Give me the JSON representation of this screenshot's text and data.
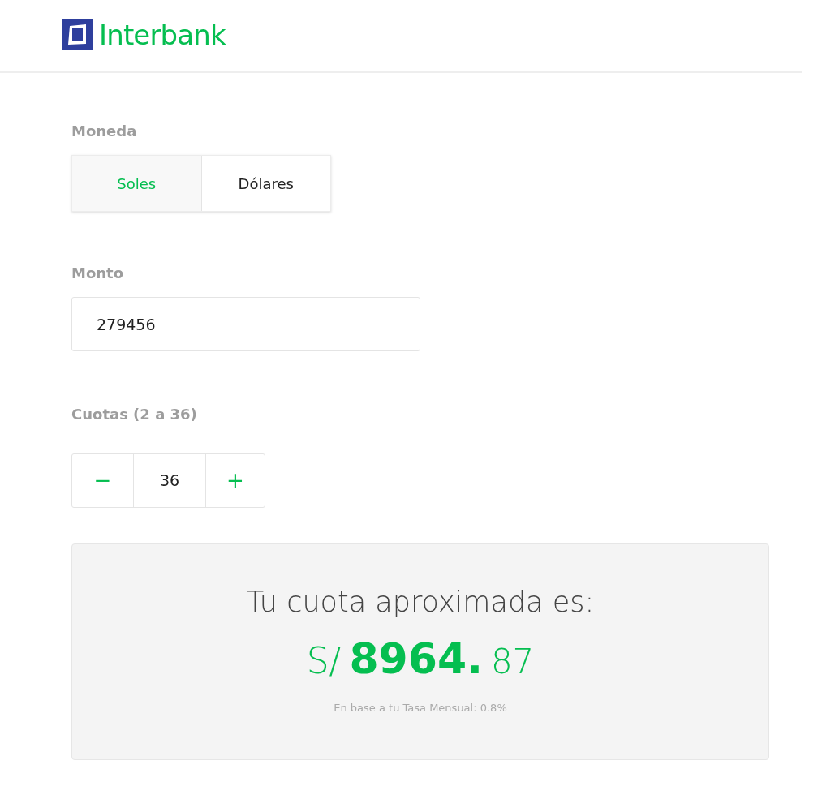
{
  "header": {
    "brand": "Interbank"
  },
  "currency": {
    "label": "Moneda",
    "options": [
      {
        "label": "Soles",
        "selected": true
      },
      {
        "label": "Dólares",
        "selected": false
      }
    ]
  },
  "amount": {
    "label": "Monto",
    "value": "279456"
  },
  "installments": {
    "label": "Cuotas (2 a 36)",
    "decrement": "−",
    "value": "36",
    "increment": "+"
  },
  "result": {
    "title": "Tu cuota aproximada es:",
    "currency": "S/",
    "integer": "8964.",
    "decimals": "87",
    "note": "En base a tu Tasa Mensual: 0.8%"
  }
}
